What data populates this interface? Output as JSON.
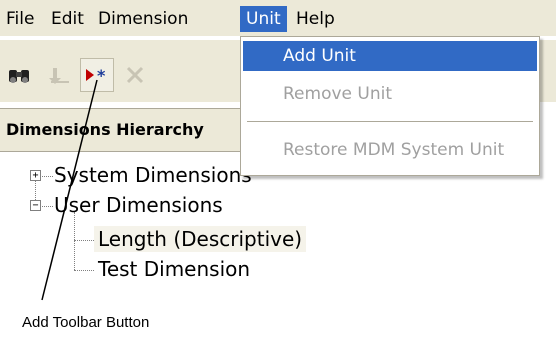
{
  "menubar": {
    "items": [
      {
        "label": "File"
      },
      {
        "label": "Edit"
      },
      {
        "label": "Dimension"
      },
      {
        "label": "Unit"
      },
      {
        "label": "Help"
      }
    ],
    "active": "Unit"
  },
  "toolbar": {
    "buttons": [
      {
        "icon": "binoculars-icon",
        "label": "Find"
      },
      {
        "icon": "move-icon",
        "label": "Move"
      },
      {
        "icon": "add-icon",
        "label": "Add"
      },
      {
        "icon": "delete-icon",
        "label": "Delete"
      }
    ]
  },
  "panel": {
    "title": "Dimensions Hierarchy"
  },
  "tree": {
    "nodes": [
      {
        "label": "System Dimensions",
        "expander": "+"
      },
      {
        "label": "User Dimensions",
        "expander": "−"
      },
      {
        "label": "Length (Descriptive)"
      },
      {
        "label": "Test Dimension"
      }
    ]
  },
  "unit_menu": {
    "items": [
      {
        "label": "Add Unit",
        "state": "highlighted"
      },
      {
        "label": "Remove Unit",
        "state": "disabled"
      },
      {
        "label": "Restore MDM System Unit",
        "state": "disabled"
      }
    ]
  },
  "callout": {
    "text": "Add Toolbar Button"
  },
  "colors": {
    "menu_highlight": "#316ac5",
    "chrome": "#ece9d8",
    "add_icon": "#c00000"
  }
}
